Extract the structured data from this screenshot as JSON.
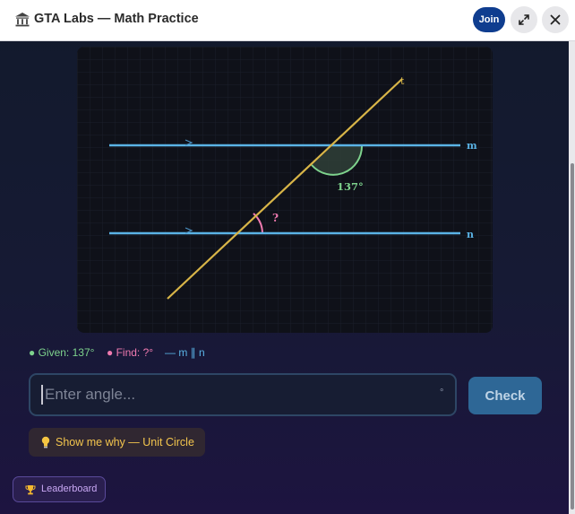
{
  "app": {
    "title": "GTA Labs — Math Practice"
  },
  "header": {
    "join_label": "Join"
  },
  "diagram": {
    "line_labels": {
      "transversal": "t",
      "upper": "m",
      "lower": "n"
    },
    "given_angle_label": "137°",
    "unknown_angle_label": "?"
  },
  "legend": {
    "given": "● Given: 137°",
    "find": "● Find: ?°",
    "parallel": "— m ∥ n"
  },
  "answer": {
    "placeholder": "Enter angle...",
    "value": "",
    "suffix": "°"
  },
  "buttons": {
    "check_label": "Check",
    "hint_label": "Show me why — Unit Circle",
    "leaderboard_label": "Leaderboard"
  },
  "colors": {
    "accent": "#0f3d8f",
    "parallel_lines": "#5ab3e6",
    "transversal": "#d8b548",
    "given": "#7ed38d",
    "unknown": "#f07ab0"
  }
}
